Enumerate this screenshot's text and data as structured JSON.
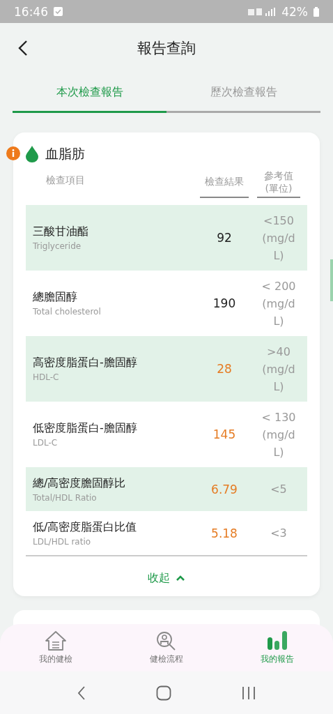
{
  "status_bar": {
    "time": "16:46",
    "battery": "42%"
  },
  "header": {
    "title": "報告查詢"
  },
  "tabs": [
    {
      "label": "本次檢查報告",
      "selected": true
    },
    {
      "label": "歷次檢查報告",
      "selected": false
    }
  ],
  "section": {
    "title": "血脂肪",
    "columns": [
      "檢查項目",
      "檢查結果",
      "參考值 (單位)"
    ],
    "rows": [
      {
        "name": "三酸甘油酯",
        "english": "Triglyceride",
        "result": "92",
        "abnormal": false,
        "reference": "<150 (mg/dL)"
      },
      {
        "name": "總膽固醇",
        "english": "Total cholesterol",
        "result": "190",
        "abnormal": false,
        "reference": "< 200 (mg/dL)"
      },
      {
        "name": "高密度脂蛋白-膽固醇",
        "english": "HDL-C",
        "result": "28",
        "abnormal": true,
        "reference": ">40 (mg/dL)"
      },
      {
        "name": "低密度脂蛋白-膽固醇",
        "english": "LDL-C",
        "result": "145",
        "abnormal": true,
        "reference": "< 130 (mg/dL)"
      },
      {
        "name": "總/高密度膽固醇比",
        "english": "Total/HDL Ratio",
        "result": "6.79",
        "abnormal": true,
        "reference": "<5"
      },
      {
        "name": "低/高密度脂蛋白比值",
        "english": "LDL/HDL ratio",
        "result": "5.18",
        "abnormal": true,
        "reference": "<3"
      }
    ],
    "collapse": "收起"
  },
  "bottom_nav": [
    {
      "label": "我的健檢",
      "kind": "home",
      "selected": false
    },
    {
      "label": "健檢流程",
      "kind": "search",
      "selected": false
    },
    {
      "label": "我的報告",
      "kind": "chart",
      "selected": true
    }
  ]
}
